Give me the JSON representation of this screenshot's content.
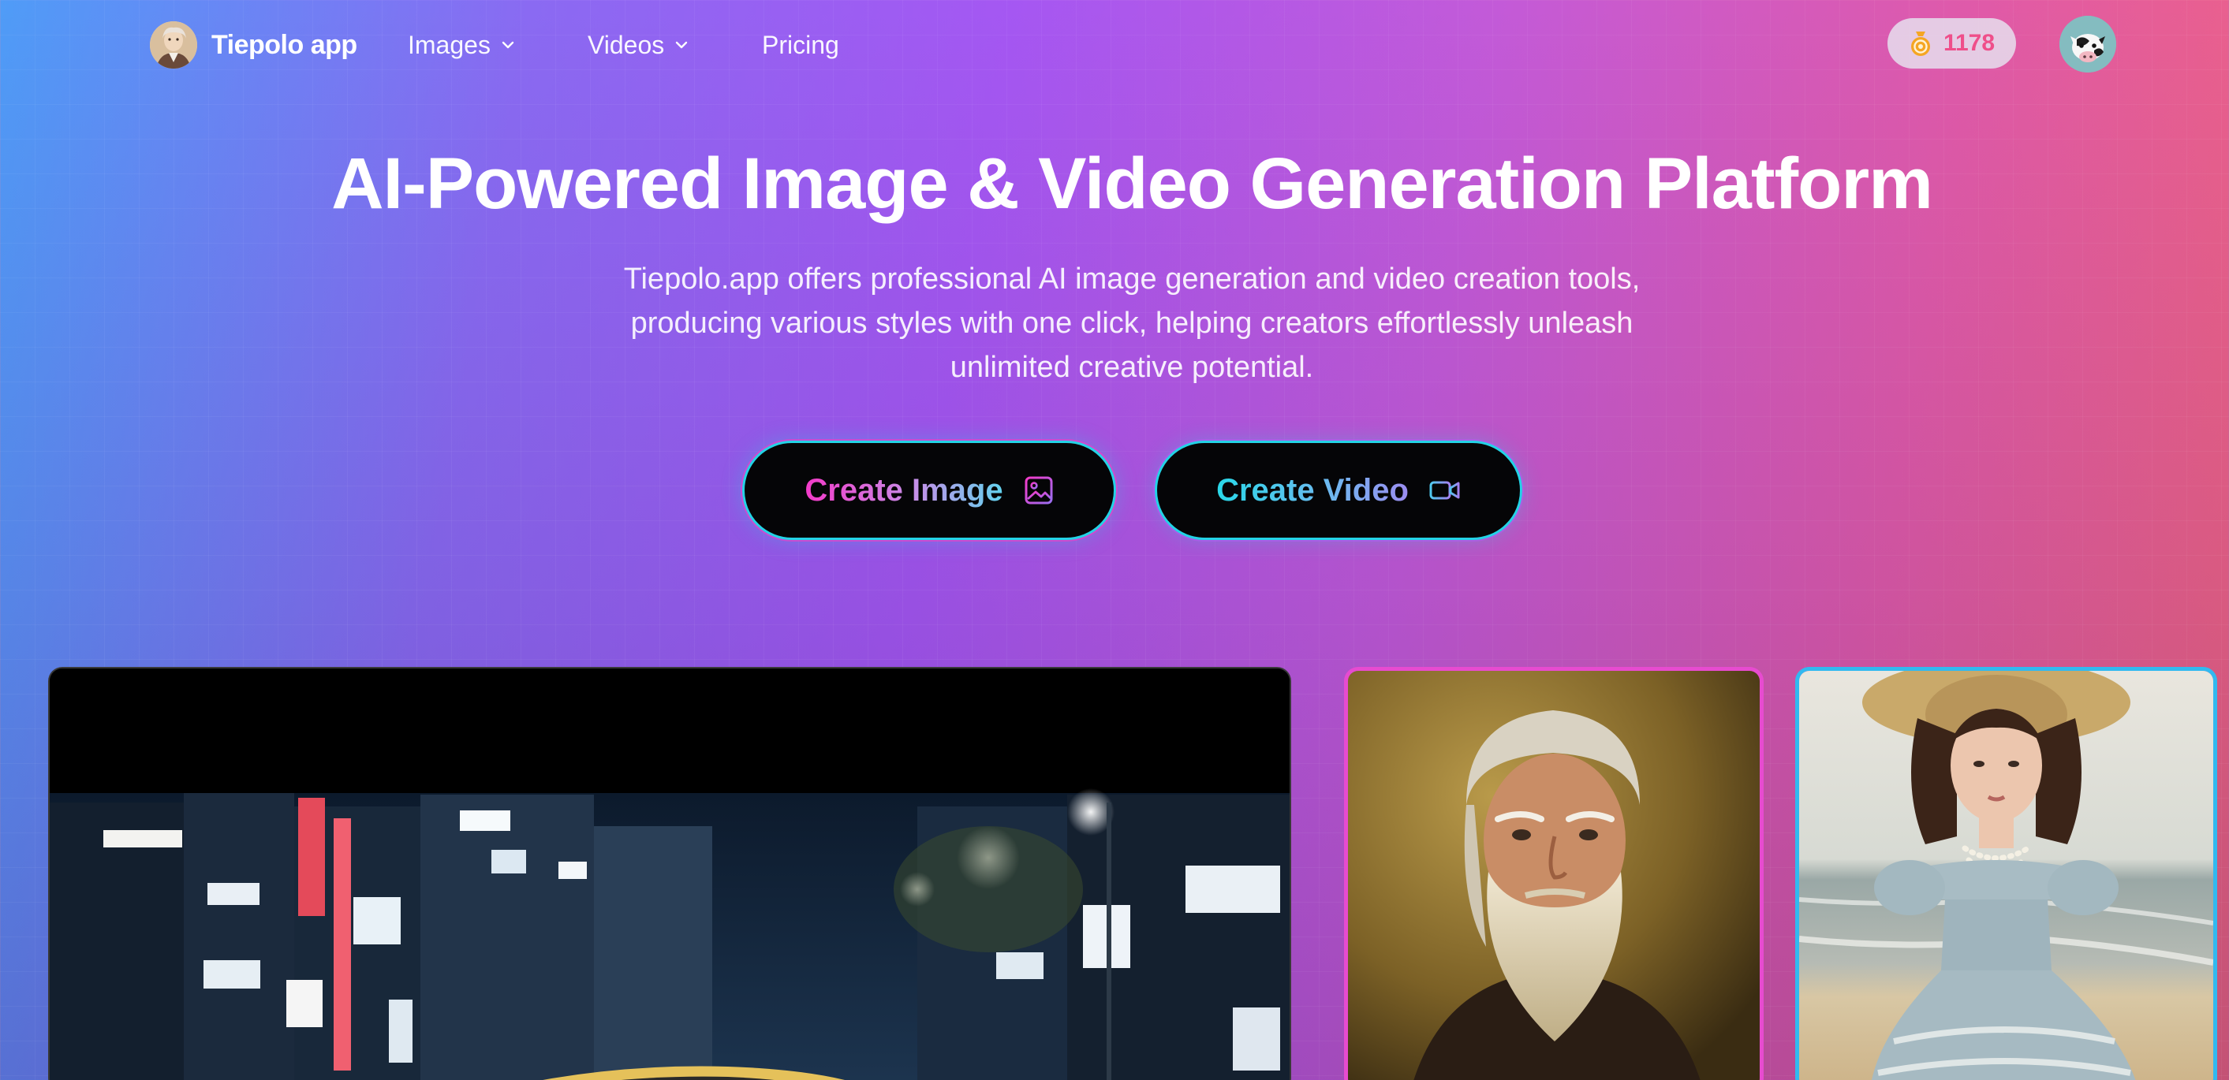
{
  "app": {
    "name": "Tiepolo app"
  },
  "nav": {
    "items": [
      {
        "label": "Images",
        "has_dropdown": true
      },
      {
        "label": "Videos",
        "has_dropdown": true
      },
      {
        "label": "Pricing",
        "has_dropdown": false
      }
    ]
  },
  "credits": {
    "value": "1178",
    "icon": "coin-icon"
  },
  "user": {
    "avatar_icon": "cow-avatar-icon"
  },
  "hero": {
    "title": "AI-Powered Image & Video Generation Platform",
    "subtitle": "Tiepolo.app offers professional AI image generation and video creation tools, producing various styles with one click, helping creators effortlessly unleash unlimited creative potential."
  },
  "actions": {
    "create_image": {
      "label": "Create Image",
      "icon": "image-icon"
    },
    "create_video": {
      "label": "Create Video",
      "icon": "video-camera-icon"
    }
  },
  "showcase": {
    "items": [
      {
        "kind": "video",
        "subject": "night-city-street"
      },
      {
        "kind": "image",
        "subject": "bearded-old-man-portrait"
      },
      {
        "kind": "image",
        "subject": "woman-in-dress-at-beach"
      }
    ]
  },
  "colors": {
    "credit_text": "#ef4f8a",
    "cta_border": "#23d3e6",
    "cta_gradient_pink": "#f33ac8",
    "cta_gradient_cyan": "#29d8e8",
    "card_border_pink": "#e74bd0",
    "card_border_blue": "#31b9f0"
  }
}
